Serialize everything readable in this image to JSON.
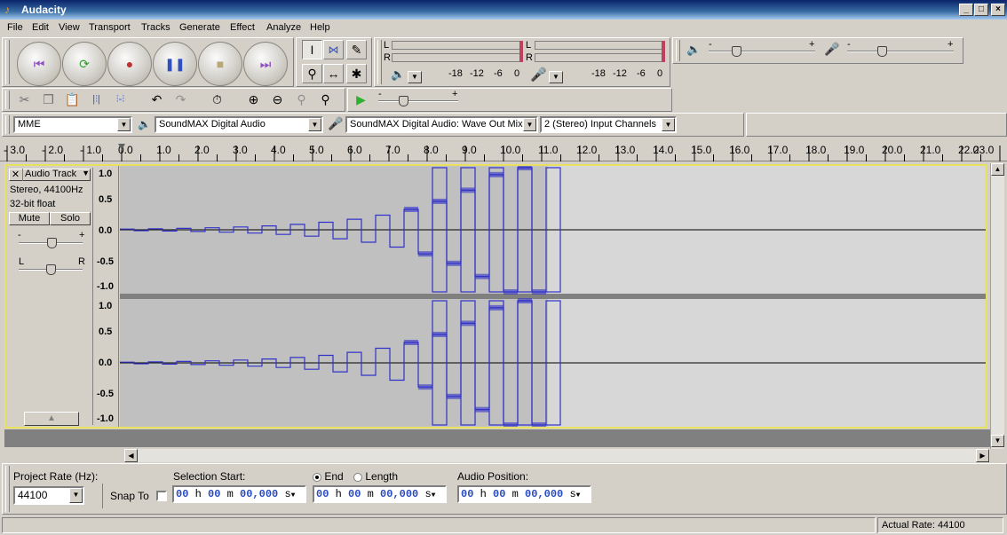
{
  "window": {
    "title": "Audacity"
  },
  "menu": [
    "File",
    "Edit",
    "View",
    "Transport",
    "Tracks",
    "Generate",
    "Effect",
    "Analyze",
    "Help"
  ],
  "meters": {
    "L": "L",
    "R": "R",
    "scale": [
      "-18",
      "-12",
      "-6",
      "0"
    ],
    "out_scale": [
      "-18",
      "-12",
      "-6",
      "0"
    ]
  },
  "mixer": {
    "minus": "-",
    "plus": "+"
  },
  "play_speed": {
    "minus": "-",
    "plus": "+"
  },
  "devices": {
    "host": "MME",
    "output": "SoundMAX Digital Audio",
    "input": "SoundMAX Digital Audio: Wave Out Mix",
    "channels": "2 (Stereo) Input Channels"
  },
  "ruler": {
    "labels": [
      "- 3.0",
      "- 2.0",
      "- 1.0",
      "0.0",
      "1.0",
      "2.0",
      "3.0",
      "4.0",
      "5.0",
      "6.0",
      "7.0",
      "8.0",
      "9.0",
      "10.0",
      "11.0",
      "12.0",
      "13.0",
      "14.0",
      "15.0",
      "16.0",
      "17.0",
      "18.0",
      "19.0",
      "20.0",
      "21.0",
      "22.0",
      "23.0"
    ]
  },
  "track": {
    "name": "Audio Track",
    "rate": "Stereo, 44100Hz",
    "format": "32-bit float",
    "mute": "Mute",
    "solo": "Solo",
    "gain_minus": "-",
    "gain_plus": "+",
    "pan_left": "L",
    "pan_right": "R",
    "yaxis": [
      "1.0",
      "0.5",
      "0.0",
      "-0.5",
      "-1.0"
    ]
  },
  "colors": {
    "waveform": "#3232c8",
    "selected_bg": "#c0c0c0",
    "empty_bg": "#d7d7d7",
    "track_border": "#e8e060"
  },
  "bottom": {
    "project_rate_label": "Project Rate (Hz):",
    "project_rate": "44100",
    "snap_to": "Snap To",
    "selection_start_label": "Selection Start:",
    "end_label": "End",
    "length_label": "Length",
    "audio_position_label": "Audio Position:",
    "time_hh": "00",
    "time_h": "h",
    "time_mm": "00",
    "time_m": "m",
    "time_ss": "00,000",
    "time_s": "s"
  },
  "status": {
    "actual_rate": "Actual Rate: 44100"
  }
}
